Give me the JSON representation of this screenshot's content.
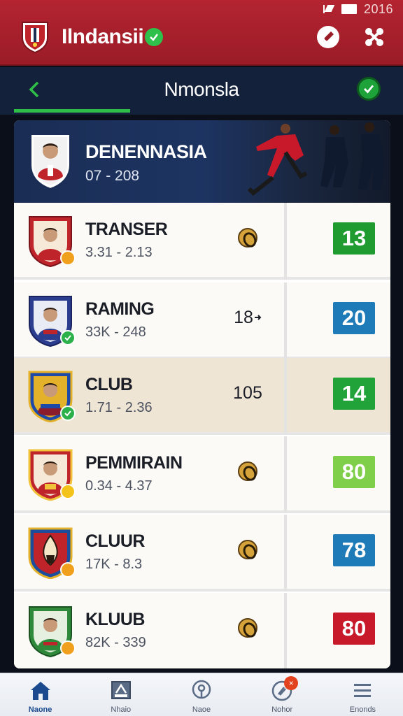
{
  "status_bar": {
    "year": "2016"
  },
  "app_bar": {
    "title": "Ilndansii"
  },
  "nav": {
    "title": "Nmonsla"
  },
  "hero": {
    "name": "DENENNASIA",
    "range": "07 - 208"
  },
  "rows": [
    {
      "name": "TRANSER",
      "range": "3.31 - 2.13",
      "mid_text": "",
      "mid_icon": "football-icon",
      "score": "13",
      "score_color": "#1f9b2f",
      "badge_color": "#f0a01c",
      "crest_colors": [
        "#c0242b",
        "#f5d43a"
      ]
    },
    {
      "name": "RAMING",
      "range": "33K - 248",
      "mid_text": "18",
      "mid_icon": "",
      "score": "20",
      "score_color": "#1e7bb8",
      "badge_color": "#2cb04a",
      "crest_colors": [
        "#2b3d8f",
        "#c0242b"
      ]
    },
    {
      "name": "CLUB",
      "range": "1.71 - 2.36",
      "mid_text": "105",
      "mid_icon": "",
      "score": "14",
      "score_color": "#22a33a",
      "badge_color": "#2cb04a",
      "crest_colors": [
        "#1d4aa8",
        "#e4b22a"
      ]
    },
    {
      "name": "PEMMIRAIN",
      "range": "0.34 - 4.37",
      "mid_text": "",
      "mid_icon": "football-icon",
      "score": "80",
      "score_color": "#7fcf4a",
      "badge_color": "#f3c31a",
      "crest_colors": [
        "#c0242b",
        "#f1c33a"
      ]
    },
    {
      "name": "CLUUR",
      "range": "17K - 8.3",
      "mid_text": "",
      "mid_icon": "football-icon",
      "score": "78",
      "score_color": "#1e7bb8",
      "badge_color": "#f0a01c",
      "crest_colors": [
        "#1a4e9c",
        "#e4b22a"
      ]
    },
    {
      "name": "KLUUB",
      "range": "82K - 339",
      "mid_text": "",
      "mid_icon": "football-icon",
      "score": "80",
      "score_color": "#c8192b",
      "badge_color": "#f0a01c",
      "crest_colors": [
        "#2e8a3a",
        "#c0242b"
      ]
    }
  ],
  "bottom_nav": [
    {
      "label": "Naone",
      "icon": "home-icon"
    },
    {
      "label": "Nhaio",
      "icon": "stadium-icon"
    },
    {
      "label": "Naoe",
      "icon": "location-icon"
    },
    {
      "label": "Nohor",
      "icon": "notification-icon"
    },
    {
      "label": "Enonds",
      "icon": "menu-icon"
    }
  ],
  "colors": {
    "brand_red": "#b42431",
    "header_navy": "#13213a",
    "accent_green": "#2fbf49",
    "active_blue": "#1b4a8f"
  }
}
